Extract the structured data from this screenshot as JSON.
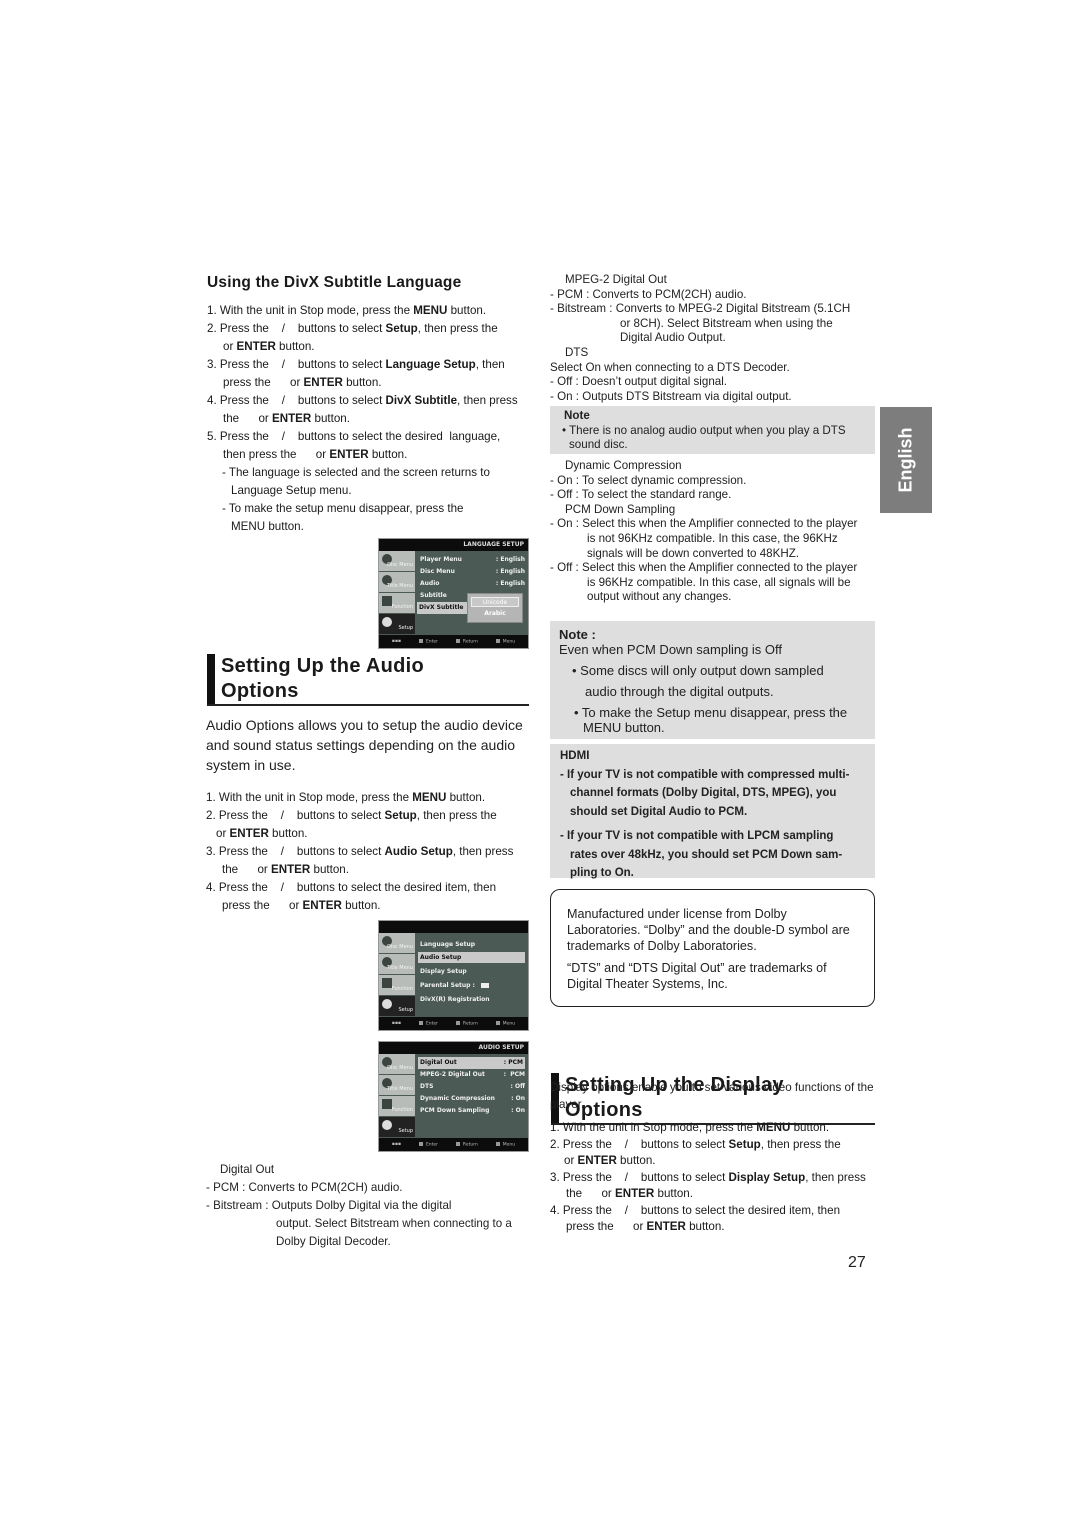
{
  "page_number": "27",
  "language_tab": "English",
  "divx_subtitle": {
    "heading": "Using the DivX Subtitle Language",
    "steps": [
      {
        "num": "1.",
        "text_a": "With the unit in Stop mode, press the ",
        "bold": "MENU",
        "text_b": " button."
      },
      {
        "num": "2.",
        "text_a": "Press the    /    buttons to select ",
        "bold": "Setup",
        "text_b": ", then press the",
        "cont_a": "or ",
        "cont_bold": "ENTER",
        "cont_b": " button."
      },
      {
        "num": "3.",
        "text_a": "Press the    /    buttons to select ",
        "bold": "Language Setup",
        "text_b": ", then",
        "cont_a": "press the      or ",
        "cont_bold": "ENTER",
        "cont_b": " button."
      },
      {
        "num": "4.",
        "text_a": "Press the    /    buttons to select ",
        "bold": "DivX Subtitle",
        "text_b": ", then press",
        "cont_a": "the      or ",
        "cont_bold": "ENTER",
        "cont_b": " button."
      },
      {
        "num": "5.",
        "text_a": "Press the    /    buttons to select the desired  language,",
        "bold": "",
        "text_b": "",
        "cont_a": "then press the      or ",
        "cont_bold": "ENTER",
        "cont_b": " button."
      }
    ],
    "sub_notes": [
      "- The language is selected and the screen returns to Language Setup menu.",
      "- To make the setup menu disappear, press the MENU button."
    ]
  },
  "osd_language": {
    "title": "LANGUAGE SETUP",
    "tabs": [
      "Disc Menu",
      "Title Menu",
      "Function",
      "Setup"
    ],
    "rows": [
      {
        "label": "Player Menu",
        "value": ": English"
      },
      {
        "label": "Disc Menu",
        "value": ": English"
      },
      {
        "label": "Audio",
        "value": ": English"
      },
      {
        "label": "Subtitle",
        "value": ""
      },
      {
        "label": "DivX Subtitle",
        "value": ""
      }
    ],
    "popup_options": [
      "Unicode",
      "Arabic"
    ],
    "footer": [
      "Enter",
      "Return",
      "Menu"
    ]
  },
  "audio_section": {
    "heading_line1": "Setting Up the Audio",
    "heading_line2": "Options",
    "intro": "Audio Options allows you to setup the audio device and sound status settings depending on the audio system in use.",
    "steps": [
      {
        "num": "1.",
        "text_a": "With the unit in Stop mode, press the ",
        "bold": "MENU",
        "text_b": " button."
      },
      {
        "num": "2.",
        "text_a": "Press the    /    buttons to select ",
        "bold": "Setup",
        "text_b": ", then press the",
        "cont_a": "or ",
        "cont_bold": "ENTER",
        "cont_b": " button."
      },
      {
        "num": "3.",
        "text_a": "Press the    /    buttons to select ",
        "bold": "Audio Setup",
        "text_b": ", then press",
        "cont_a": "the      or ",
        "cont_bold": "ENTER",
        "cont_b": " button."
      },
      {
        "num": "4.",
        "text_a": "Press the    /    buttons to select the desired item, then",
        "bold": "",
        "text_b": "",
        "cont_a": "press the      or ",
        "cont_bold": "ENTER",
        "cont_b": " button."
      }
    ]
  },
  "osd_setup": {
    "title": "",
    "tabs": [
      "Disc Menu",
      "Title Menu",
      "Function",
      "Setup"
    ],
    "rows": [
      "Language Setup",
      "Audio Setup",
      "Display Setup",
      "Parental Setup :",
      "DivX(R) Registration"
    ],
    "selected_index": 1,
    "footer": [
      "Enter",
      "Return",
      "Menu"
    ]
  },
  "osd_audio": {
    "title": "AUDIO SETUP",
    "tabs": [
      "Disc Menu",
      "Title Menu",
      "Function",
      "Setup"
    ],
    "rows": [
      {
        "label": "Digital Out",
        "value": ": PCM"
      },
      {
        "label": "MPEG-2 Digital Out",
        "value": ":  PCM"
      },
      {
        "label": "DTS",
        "value": ": Off"
      },
      {
        "label": "Dynamic Compression",
        "value": ": On"
      },
      {
        "label": "PCM Down Sampling",
        "value": ": On"
      }
    ],
    "selected_index": 0,
    "footer": [
      "Enter",
      "Return",
      "Menu"
    ]
  },
  "digital_out": {
    "title": "Digital Out",
    "pcm": "- PCM : Converts to PCM(2CH) audio.",
    "bitstream_a": "- Bitstream : Outputs Dolby Digital via the digital",
    "bitstream_b": "output. Select Bitstream when connecting to a",
    "bitstream_c": "Dolby Digital Decoder."
  },
  "mpeg2_out": {
    "title": "MPEG-2 Digital Out",
    "pcm": "- PCM : Converts to PCM(2CH) audio.",
    "bitstream_a": "- Bitstream : Converts to MPEG-2 Digital Bitstream (5.1CH",
    "bitstream_b": "or 8CH). Select Bitstream when using the",
    "bitstream_c": "Digital Audio Output."
  },
  "dts": {
    "title": "DTS",
    "desc": "Select On when connecting to a DTS Decoder.",
    "off": "- Off : Doesn’t output digital signal.",
    "on": "- On : Outputs DTS Bitstream via digital output."
  },
  "dts_note": {
    "label": "Note",
    "text": "• There is no analog audio output when you play a DTS sound disc."
  },
  "dynamic_compression": {
    "title": "Dynamic Compression",
    "on": "- On : To select dynamic compression.",
    "off": "- Off : To select the standard range."
  },
  "pcm_down": {
    "title": "PCM Down Sampling",
    "on_a": "- On : Select this when the Amplifier connected to the player",
    "on_b": "is not 96KHz compatible. In this case, the 96KHz",
    "on_c": "signals will be down converted to 48KHZ.",
    "off_a": "- Off : Select this when the Amplifier connected to the player",
    "off_b": "is 96KHz compatible. In this case, all signals will be",
    "off_c": "output without any changes."
  },
  "pcm_note": {
    "label": "Note :",
    "line": "Even when PCM Down sampling is Off",
    "bullet1_a": "• Some discs will only output down sampled",
    "bullet1_b": "audio through the digital outputs.",
    "bullet2_a": "• To make the Setup menu disappear, press the",
    "bullet2_b": "MENU button."
  },
  "hdmi_note": {
    "label": "HDMI",
    "item1_a": "- If your TV is not compatible with compressed multi-",
    "item1_b": "channel formats (Dolby Digital, DTS, MPEG), you",
    "item1_c": "should set Digital Audio to PCM.",
    "item2_a": "- If your TV is not compatible with LPCM sampling",
    "item2_b": "rates over 48kHz, you should set PCM Down sam-",
    "item2_c": "pling to On."
  },
  "license": {
    "dolby": "Manufactured under license from Dolby Laboratories. “Dolby” and the double-D symbol are trademarks of Dolby Laboratories.",
    "dts": "“DTS” and “DTS Digital Out” are trademarks of Digital Theater Systems, Inc."
  },
  "display_section": {
    "heading_line1": "Setting Up the Display",
    "heading_line2": "Options",
    "intro": "Display options enable you to set various video functions of the player.",
    "steps": [
      {
        "num": "1.",
        "text_a": "With the unit in Stop mode, press the ",
        "bold": "MENU",
        "text_b": " button."
      },
      {
        "num": "2.",
        "text_a": "Press the    /    buttons to select ",
        "bold": "Setup",
        "text_b": ", then press the",
        "cont_a": "or ",
        "cont_bold": "ENTER",
        "cont_b": " button."
      },
      {
        "num": "3.",
        "text_a": "Press the    /    buttons to select ",
        "bold": "Display Setup",
        "text_b": ", then press",
        "cont_a": "the      or ",
        "cont_bold": "ENTER",
        "cont_b": " button."
      },
      {
        "num": "4.",
        "text_a": "Press the    /    buttons to select the desired item, then",
        "bold": "",
        "text_b": "",
        "cont_a": "press the      or ",
        "cont_bold": "ENTER",
        "cont_b": " button."
      }
    ]
  }
}
